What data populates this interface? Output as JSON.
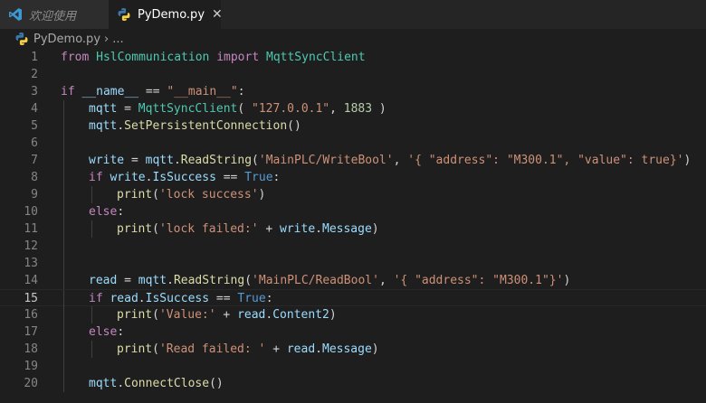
{
  "tabs": [
    {
      "label": "欢迎使用",
      "icon": "vscode-icon",
      "active": false
    },
    {
      "label": "PyDemo.py",
      "icon": "python-icon",
      "active": true,
      "close": "✕"
    }
  ],
  "breadcrumb": {
    "file": "PyDemo.py",
    "icon": "python-icon",
    "sep": "›",
    "more": "..."
  },
  "editor": {
    "current_line": 15,
    "lines": [
      {
        "n": "1",
        "guides": 0,
        "tokens": [
          [
            "kw",
            "from"
          ],
          [
            "p",
            " "
          ],
          [
            "cls",
            "HslCommunication"
          ],
          [
            "p",
            " "
          ],
          [
            "kw",
            "import"
          ],
          [
            "p",
            " "
          ],
          [
            "cls",
            "MqttSyncClient"
          ]
        ]
      },
      {
        "n": "2",
        "guides": 0,
        "tokens": []
      },
      {
        "n": "3",
        "guides": 0,
        "tokens": [
          [
            "kw",
            "if"
          ],
          [
            "p",
            " "
          ],
          [
            "var",
            "__name__"
          ],
          [
            "p",
            " == "
          ],
          [
            "str",
            "\"__main__\""
          ],
          [
            "p",
            ":"
          ]
        ]
      },
      {
        "n": "4",
        "guides": 1,
        "tokens": [
          [
            "var",
            "mqtt"
          ],
          [
            "p",
            " = "
          ],
          [
            "cls",
            "MqttSyncClient"
          ],
          [
            "p",
            "( "
          ],
          [
            "str",
            "\"127.0.0.1\""
          ],
          [
            "p",
            ", "
          ],
          [
            "num",
            "1883"
          ],
          [
            "p",
            " )"
          ]
        ]
      },
      {
        "n": "5",
        "guides": 1,
        "tokens": [
          [
            "var",
            "mqtt"
          ],
          [
            "p",
            "."
          ],
          [
            "fn",
            "SetPersistentConnection"
          ],
          [
            "p",
            "()"
          ]
        ]
      },
      {
        "n": "6",
        "guides": 1,
        "tokens": []
      },
      {
        "n": "7",
        "guides": 1,
        "tokens": [
          [
            "var",
            "write"
          ],
          [
            "p",
            " = "
          ],
          [
            "var",
            "mqtt"
          ],
          [
            "p",
            "."
          ],
          [
            "fn",
            "ReadString"
          ],
          [
            "p",
            "("
          ],
          [
            "str",
            "'MainPLC/WriteBool'"
          ],
          [
            "p",
            ", "
          ],
          [
            "str",
            "'{ \"address\": \"M300.1\", \"value\": true}'"
          ],
          [
            "p",
            ")"
          ]
        ]
      },
      {
        "n": "8",
        "guides": 1,
        "tokens": [
          [
            "kw",
            "if"
          ],
          [
            "p",
            " "
          ],
          [
            "var",
            "write"
          ],
          [
            "p",
            "."
          ],
          [
            "var",
            "IsSuccess"
          ],
          [
            "p",
            " == "
          ],
          [
            "kb",
            "True"
          ],
          [
            "p",
            ":"
          ]
        ]
      },
      {
        "n": "9",
        "guides": 2,
        "tokens": [
          [
            "fn",
            "print"
          ],
          [
            "p",
            "("
          ],
          [
            "str",
            "'lock success'"
          ],
          [
            "p",
            ")"
          ]
        ]
      },
      {
        "n": "10",
        "guides": 1,
        "tokens": [
          [
            "kw",
            "else"
          ],
          [
            "p",
            ":"
          ]
        ]
      },
      {
        "n": "11",
        "guides": 2,
        "tokens": [
          [
            "fn",
            "print"
          ],
          [
            "p",
            "("
          ],
          [
            "str",
            "'lock failed:'"
          ],
          [
            "p",
            " + "
          ],
          [
            "var",
            "write"
          ],
          [
            "p",
            "."
          ],
          [
            "var",
            "Message"
          ],
          [
            "p",
            ")"
          ]
        ]
      },
      {
        "n": "12",
        "guides": 1,
        "tokens": []
      },
      {
        "n": "13",
        "guides": 1,
        "tokens": []
      },
      {
        "n": "14",
        "guides": 1,
        "tokens": [
          [
            "var",
            "read"
          ],
          [
            "p",
            " = "
          ],
          [
            "var",
            "mqtt"
          ],
          [
            "p",
            "."
          ],
          [
            "fn",
            "ReadString"
          ],
          [
            "p",
            "("
          ],
          [
            "str",
            "'MainPLC/ReadBool'"
          ],
          [
            "p",
            ", "
          ],
          [
            "str",
            "'{ \"address\": \"M300.1\"}'"
          ],
          [
            "p",
            ")"
          ]
        ]
      },
      {
        "n": "15",
        "guides": 1,
        "tokens": [
          [
            "kw",
            "if"
          ],
          [
            "p",
            " "
          ],
          [
            "var",
            "read"
          ],
          [
            "p",
            "."
          ],
          [
            "var",
            "IsSuccess"
          ],
          [
            "p",
            " == "
          ],
          [
            "kb",
            "True"
          ],
          [
            "p",
            ":"
          ]
        ]
      },
      {
        "n": "16",
        "guides": 2,
        "tokens": [
          [
            "fn",
            "print"
          ],
          [
            "p",
            "("
          ],
          [
            "str",
            "'Value:'"
          ],
          [
            "p",
            " + "
          ],
          [
            "var",
            "read"
          ],
          [
            "p",
            "."
          ],
          [
            "var",
            "Content2"
          ],
          [
            "p",
            ")"
          ]
        ]
      },
      {
        "n": "17",
        "guides": 1,
        "tokens": [
          [
            "kw",
            "else"
          ],
          [
            "p",
            ":"
          ]
        ]
      },
      {
        "n": "18",
        "guides": 2,
        "tokens": [
          [
            "fn",
            "print"
          ],
          [
            "p",
            "("
          ],
          [
            "str",
            "'Read failed: '"
          ],
          [
            "p",
            " + "
          ],
          [
            "var",
            "read"
          ],
          [
            "p",
            "."
          ],
          [
            "var",
            "Message"
          ],
          [
            "p",
            ")"
          ]
        ]
      },
      {
        "n": "19",
        "guides": 1,
        "tokens": []
      },
      {
        "n": "20",
        "guides": 1,
        "tokens": [
          [
            "var",
            "mqtt"
          ],
          [
            "p",
            "."
          ],
          [
            "fn",
            "ConnectClose"
          ],
          [
            "p",
            "()"
          ]
        ]
      }
    ]
  },
  "colors": {
    "background": "#1e1e1e",
    "keyword": "#c586c0",
    "builtin": "#569cd6",
    "class": "#4ec9b0",
    "string": "#ce9178",
    "number": "#b5cea8",
    "function": "#dcdcaa",
    "variable": "#9cdcfe"
  }
}
